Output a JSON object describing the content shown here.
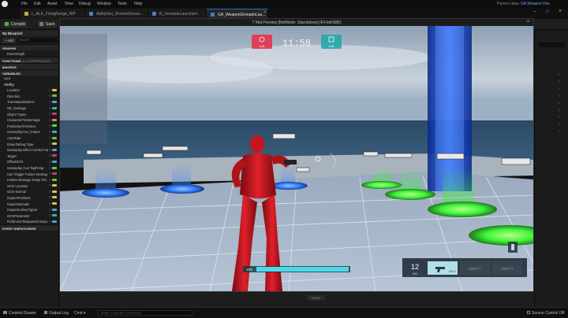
{
  "menu": {
    "items": [
      "File",
      "Edit",
      "Asset",
      "View",
      "Debug",
      "Window",
      "Tools",
      "Help"
    ],
    "parent_class_label": "Parent class:",
    "parent_class_value": "GA Weapon Fire"
  },
  "tabs": [
    {
      "label": "L_ALE_FiringRange_WP"
    },
    {
      "label": "AbilitySet_ShooterGrena..."
    },
    {
      "label": "B_GrenadeLauncher+"
    },
    {
      "label": "GA_WeaponGrenadeLau..."
    }
  ],
  "toolbar": {
    "compile_label": "Compile",
    "save_label": "Save"
  },
  "left_panel": {
    "my_blueprint_label": "My Blueprint",
    "add_label": "+ Add",
    "search_placeholder": "Search",
    "graphs_label": "GRAPHS",
    "event_graph_label": "EventGraph",
    "functions_label": "FUNCTIONS",
    "functions_count": "(11 OVERRIDABLE)",
    "macros_label": "MACROS",
    "variables_label": "VARIABLES",
    "variable_groups": [
      "Lyra",
      "Ability"
    ],
    "variables": [
      "Location",
      "Direction",
      "TraceMaxDistance",
      "GE_Damage",
      "Object Types",
      "CharacterFireMontage",
      "FireDelayTimeSecs",
      "GameplayCue_Impact",
      "AutoRate",
      "Draw Debug Type",
      "Gameplay Effect Control Ha",
      "Target",
      "OffsetGCN",
      "Gameplay Cue TagFiring",
      "Can Trigger Failure Montag",
      "Failure Montage Delay Tim",
      "GCN Location",
      "GCN Normal",
      "ImpactPositions",
      "ImpactNormals",
      "ImpactSurfaceTypes",
      "GCNParameter",
      "FieldActorToSpawnOnImpa"
    ],
    "event_dispatchers_label": "EVENT DISPATCHERS"
  },
  "viewport": {
    "title": "T Mal Preview [NetMode: Standalone] (64-bit/SM5)",
    "hud": {
      "timer": "11:58",
      "red_team_score": "115",
      "blue_team_score": "105",
      "ammo_current": "12",
      "ammo_reserve": "400",
      "health_value": "100",
      "weapon_slot_active": "GA 2",
      "weapon_slot_empty_1": "EMPTY",
      "weapon_slot_empty_2": "EMPTY"
    }
  },
  "graph_strip": {
    "page_label": "PAGE"
  },
  "bottom_bar": {
    "content_drawer_label": "Content Drawer",
    "output_log_label": "Output Log",
    "cmd_label": "Cmd",
    "console_placeholder": "Enter Console Command",
    "source_control_label": "Source Control Off",
    "clear_label": "CLEAR"
  },
  "colors": {
    "accent_blue": "#1e6fd0",
    "pad_green": "#3df23a",
    "pad_blue": "#2f7bff",
    "hud_red": "#e3344f",
    "hud_cyan": "#23d8d8",
    "char_red": "#c8141e"
  }
}
